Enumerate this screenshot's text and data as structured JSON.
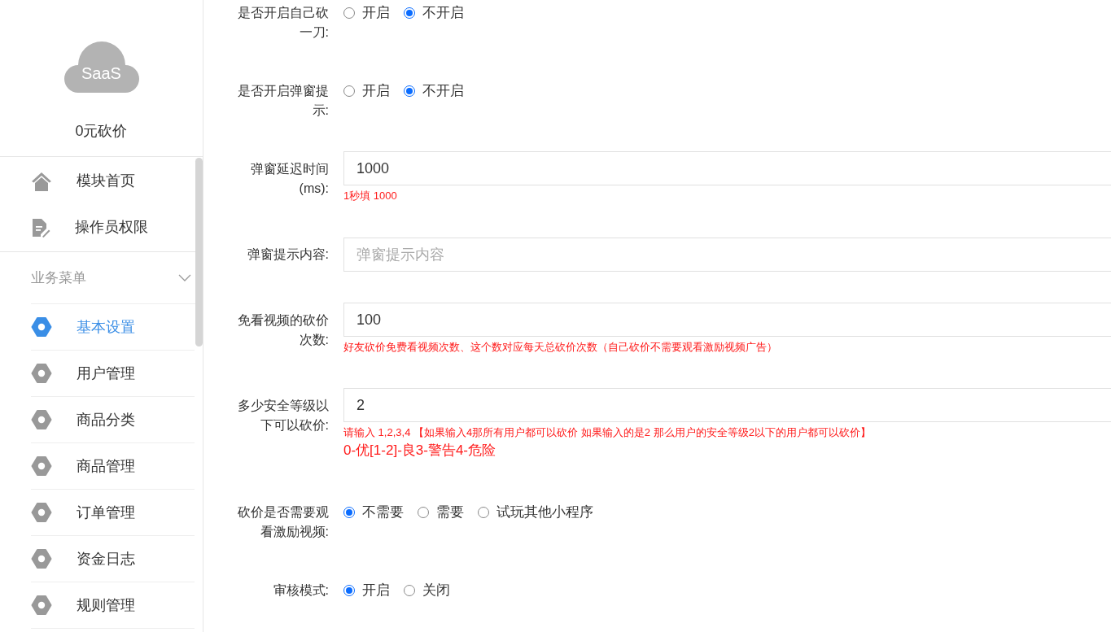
{
  "sidebar": {
    "logo_text": "SaaS",
    "app_name": "0元砍价",
    "items": [
      {
        "label": "模块首页",
        "kind": "home",
        "selected": false
      },
      {
        "label": "操作员权限",
        "kind": "document",
        "selected": false
      }
    ],
    "section": {
      "title": "业务菜单",
      "expanded": true,
      "items": [
        {
          "label": "基本设置",
          "selected": true
        },
        {
          "label": "用户管理",
          "selected": false
        },
        {
          "label": "商品分类",
          "selected": false
        },
        {
          "label": "商品管理",
          "selected": false
        },
        {
          "label": "订单管理",
          "selected": false
        },
        {
          "label": "资金日志",
          "selected": false
        },
        {
          "label": "规则管理",
          "selected": false
        }
      ]
    }
  },
  "form": [
    {
      "kind": "radio",
      "label": "是否开启自己砍一刀:",
      "options": [
        {
          "label": "开启",
          "selected": false
        },
        {
          "label": "不开启",
          "selected": true
        }
      ]
    },
    {
      "kind": "radio",
      "label": "是否开启弹窗提示:",
      "options": [
        {
          "label": "开启",
          "selected": false
        },
        {
          "label": "不开启",
          "selected": true
        }
      ]
    },
    {
      "kind": "input",
      "label": "弹窗延迟时间(ms):",
      "value": "1000",
      "hints": [
        {
          "kind": "note",
          "text": "1秒填 1000"
        }
      ]
    },
    {
      "kind": "input",
      "label": "弹窗提示内容:",
      "placeholder": "弹窗提示内容"
    },
    {
      "kind": "input",
      "label": "免看视频的砍价次数:",
      "value": "100",
      "hints": [
        {
          "kind": "note",
          "text": "好友砍价免费看视频次数、这个数对应每天总砍价次数（自己砍价不需要观看激励视频广告）"
        }
      ]
    },
    {
      "kind": "input",
      "label": "多少安全等级以下可以砍价:",
      "value": "2",
      "hints": [
        {
          "kind": "note",
          "text": "请输入 1,2,3,4 【如果输入4那所有用户都可以砍价 如果输入的是2 那么用户的安全等级2以下的用户都可以砍价】"
        },
        {
          "kind": "legend",
          "text": "0-优[1-2]-良3-警告4-危险"
        }
      ]
    },
    {
      "kind": "radio",
      "label": "砍价是否需要观看激励视频:",
      "options": [
        {
          "label": "不需要",
          "selected": true
        },
        {
          "label": "需要",
          "selected": false
        },
        {
          "label": "试玩其他小程序",
          "selected": false
        }
      ]
    },
    {
      "kind": "radio",
      "label": "审核模式:",
      "options": [
        {
          "label": "开启",
          "selected": true
        },
        {
          "label": "关闭",
          "selected": false
        }
      ]
    }
  ]
}
